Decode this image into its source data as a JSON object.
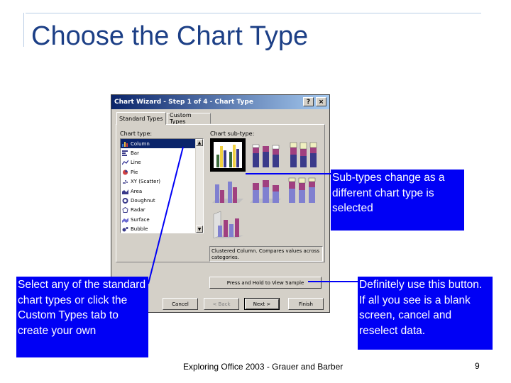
{
  "slide": {
    "title": "Choose the Chart Type",
    "footer": "Exploring Office 2003 - Grauer and Barber",
    "page_number": "9"
  },
  "dialog": {
    "title": "Chart Wizard - Step 1 of 4 - Chart Type",
    "help_label": "?",
    "close_label": "×",
    "tabs": [
      {
        "label": "Standard Types",
        "selected": true
      },
      {
        "label": "Custom Types",
        "selected": false
      }
    ],
    "chart_type_label": "Chart type:",
    "chart_subtype_label": "Chart sub-type:",
    "chart_types": [
      {
        "label": "Column",
        "icon": "column-chart-icon",
        "selected": true
      },
      {
        "label": "Bar",
        "icon": "bar-chart-icon"
      },
      {
        "label": "Line",
        "icon": "line-chart-icon"
      },
      {
        "label": "Pie",
        "icon": "pie-chart-icon"
      },
      {
        "label": "XY (Scatter)",
        "icon": "scatter-chart-icon"
      },
      {
        "label": "Area",
        "icon": "area-chart-icon"
      },
      {
        "label": "Doughnut",
        "icon": "doughnut-chart-icon"
      },
      {
        "label": "Radar",
        "icon": "radar-chart-icon"
      },
      {
        "label": "Surface",
        "icon": "surface-chart-icon"
      },
      {
        "label": "Bubble",
        "icon": "bubble-chart-icon"
      }
    ],
    "description": "Clustered Column. Compares values across categories.",
    "press_hold_label": "Press and Hold to View Sample",
    "cancel_label": "Cancel",
    "back_label": "< Back",
    "next_label": "Next >",
    "finish_label": "Finish"
  },
  "callouts": {
    "subtypes": "Sub-types change as a different chart type is selected",
    "select": "Select any of the standard chart types or click the Custom Types tab to create your own",
    "definitely": "Definitely use this button.  If all you see is a blank screen, cancel and reselect data."
  },
  "colors": {
    "title": "#1c3f86",
    "callout_bg": "#0000f5",
    "dialog_bg": "#d4d0c8",
    "titlebar": "#0a246a"
  }
}
